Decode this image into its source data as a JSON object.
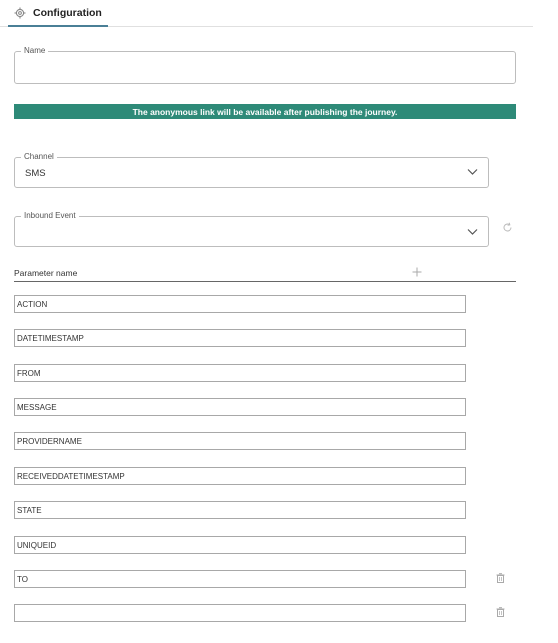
{
  "tabs": [
    {
      "label": "Configuration",
      "icon": "gear-icon",
      "active": true
    }
  ],
  "name_field": {
    "legend": "Name",
    "value": ""
  },
  "banner": {
    "text": "The anonymous link will be available after publishing the journey.",
    "color": "#2e8a78"
  },
  "channel_field": {
    "legend": "Channel",
    "value": "SMS"
  },
  "inbound_event_field": {
    "legend": "Inbound Event",
    "value": ""
  },
  "parameters": {
    "header_label": "Parameter name",
    "rows": [
      {
        "value": "ACTION"
      },
      {
        "value": "DATETIMESTAMP"
      },
      {
        "value": "FROM"
      },
      {
        "value": "MESSAGE"
      },
      {
        "value": "PROVIDERNAME"
      },
      {
        "value": "RECEIVEDDATETIMESTAMP"
      },
      {
        "value": "STATE"
      },
      {
        "value": "UNIQUEID"
      },
      {
        "value": "TO"
      },
      {
        "value": ""
      }
    ]
  }
}
